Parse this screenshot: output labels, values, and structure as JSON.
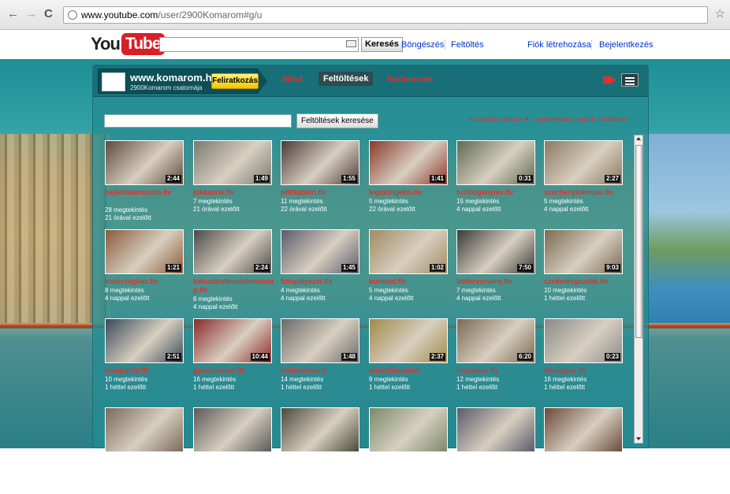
{
  "browser": {
    "url_host": "www.youtube.com",
    "url_path": "/user/2900Komarom#g/u"
  },
  "yt": {
    "logo_you": "You",
    "logo_tube": "Tube",
    "search_button": "Keresés",
    "links": [
      "Böngészés",
      "Feltöltés",
      "Fiók létrehozása",
      "Bejelentkezés"
    ]
  },
  "channel": {
    "name": "www.komarom.hu",
    "subtitle": "2900Komarom csatornája",
    "subscribe": "Feliratkozás",
    "tabs": [
      "Mind",
      "Feltöltések",
      "Kedvencek"
    ],
    "active_tab": "Feltöltések",
    "upload_search_button": "Feltöltések keresése",
    "sort": {
      "added": "Hozzáadás dátuma",
      "popular": "Legnézettebb",
      "rated": "Legjobb minősítésű"
    }
  },
  "videos": [
    {
      "title": "hajlektalanszallo.flv",
      "duration": "2:44",
      "views": "28 megtekintés",
      "age": "21 órával ezelőtt",
      "color": "#5d4a3e"
    },
    {
      "title": "jokaanna.flv",
      "duration": "1:49",
      "views": "7 megtekintés",
      "age": "21 órával ezelőtt",
      "color": "#7a7a70"
    },
    {
      "title": "pittikatalin.flv",
      "duration": "1:55",
      "views": "11 megtekintés",
      "age": "22 órával ezelőtt",
      "color": "#4a3a3a"
    },
    {
      "title": "legiobrigetio.flv",
      "duration": "1:41",
      "views": "5 megtekintés",
      "age": "22 órával ezelőtt",
      "color": "#8a3a2c"
    },
    {
      "title": "tuzifaigenyles.flv",
      "duration": "0:31",
      "views": "15 megtekintés",
      "age": "4 nappal ezelőtt",
      "color": "#5f6a52"
    },
    {
      "title": "szechenyiolimpia.flv",
      "duration": "2:27",
      "views": "5 megtekintés",
      "age": "4 nappal ezelőtt",
      "color": "#8a7a62"
    },
    {
      "title": "kisterseghaz.flv",
      "duration": "1:21",
      "views": "8 megtekintés",
      "age": "4 nappal ezelőtt",
      "color": "#8a5a3a"
    },
    {
      "title": "katasztrofavedelemtana p.flv",
      "duration": "2:24",
      "views": "6 megtekintés",
      "age": "4 nappal ezelőtt",
      "color": "#4a4a4a"
    },
    {
      "title": "fotopalyazat.flv",
      "duration": "1:45",
      "views": "4 megtekintés",
      "age": "4 nappal ezelőtt",
      "color": "#5a5a6a"
    },
    {
      "title": "burnout.flv",
      "duration": "1:02",
      "views": "5 megtekintés",
      "age": "4 nappal ezelőtt",
      "color": "#a08a62"
    },
    {
      "title": "bollerverseny.flv",
      "duration": "7:50",
      "views": "7 megtekintés",
      "age": "4 nappal ezelőtt",
      "color": "#3a3a3a"
    },
    {
      "title": "szekeresgazdak.flv",
      "duration": "9:03",
      "views": "10 megtekintés",
      "age": "1 héttel ezelőtt",
      "color": "#7a6a52"
    },
    {
      "title": "komportal.flv",
      "duration": "2:51",
      "views": "10 megtekintés",
      "age": "1 héttel ezelőtt",
      "color": "#3a4a5a"
    },
    {
      "title": "garaboncias.flv",
      "duration": "10:44",
      "views": "16 megtekintés",
      "age": "1 héttel ezelőtt",
      "color": "#8a2a2a"
    },
    {
      "title": "bollerverseny",
      "duration": "1:48",
      "views": "14 megtekintés",
      "age": "1 héttel ezelőtt",
      "color": "#6a6a6a"
    },
    {
      "title": "adventelozetes",
      "duration": "2:37",
      "views": "9 megtekintés",
      "age": "1 héttel ezelőtt",
      "color": "#a08a4a"
    },
    {
      "title": "muzsikas.flv",
      "duration": "6:20",
      "views": "12 megtekintés",
      "age": "1 héttel ezelőtt",
      "color": "#7a6a52"
    },
    {
      "title": "fakivagas.flv",
      "duration": "0:23",
      "views": "16 megtekintés",
      "age": "1 héttel ezelőtt",
      "color": "#8a8a8a"
    },
    {
      "title": "",
      "duration": "",
      "views": "",
      "age": "",
      "color": "#7a6a5a"
    },
    {
      "title": "",
      "duration": "",
      "views": "",
      "age": "",
      "color": "#5a5a5a"
    },
    {
      "title": "",
      "duration": "",
      "views": "",
      "age": "",
      "color": "#4a4a3a"
    },
    {
      "title": "",
      "duration": "",
      "views": "",
      "age": "",
      "color": "#7a8a6a"
    },
    {
      "title": "",
      "duration": "",
      "views": "",
      "age": "",
      "color": "#5a5a6a"
    },
    {
      "title": "",
      "duration": "",
      "views": "",
      "age": "",
      "color": "#6a4a3a"
    }
  ]
}
